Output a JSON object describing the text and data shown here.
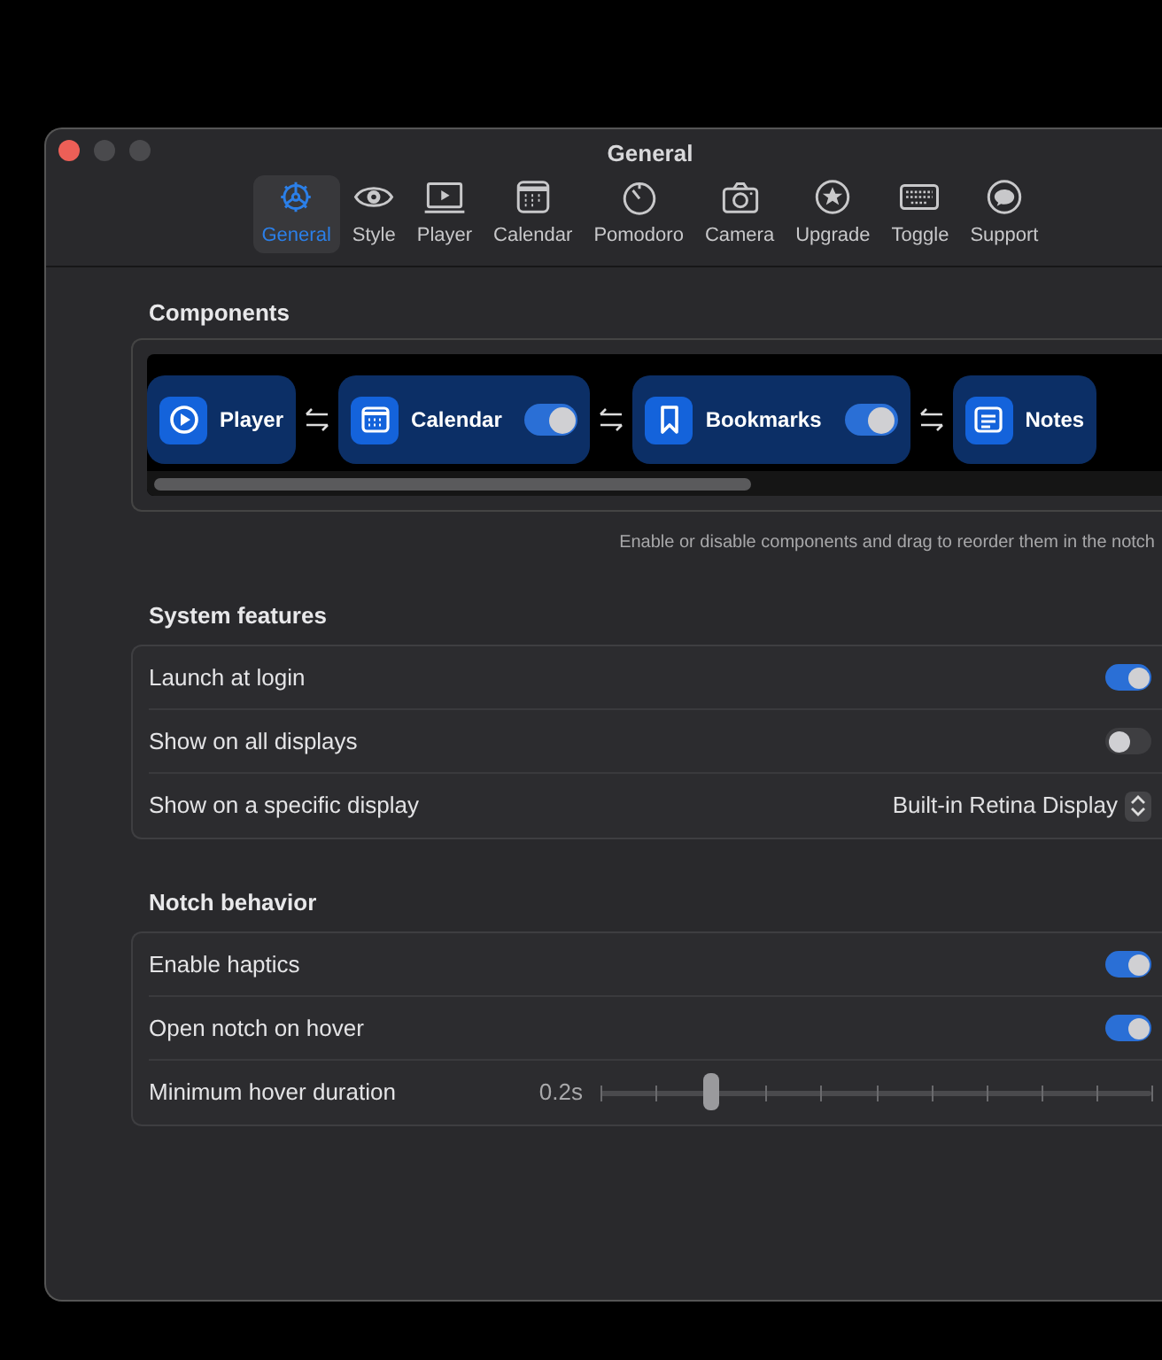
{
  "window": {
    "title": "General"
  },
  "tabs": [
    {
      "label": "General",
      "selected": true
    },
    {
      "label": "Style",
      "selected": false
    },
    {
      "label": "Player",
      "selected": false
    },
    {
      "label": "Calendar",
      "selected": false
    },
    {
      "label": "Pomodoro",
      "selected": false
    },
    {
      "label": "Camera",
      "selected": false
    },
    {
      "label": "Upgrade",
      "selected": false
    },
    {
      "label": "Toggle",
      "selected": false
    },
    {
      "label": "Support",
      "selected": false
    }
  ],
  "components": {
    "title": "Components",
    "items": [
      {
        "label": "Player",
        "kind": "plain"
      },
      {
        "label": "Calendar",
        "kind": "toggle",
        "on": true
      },
      {
        "label": "Bookmarks",
        "kind": "toggle",
        "on": true
      },
      {
        "label": "Notes",
        "kind": "plain"
      }
    ],
    "caption": "Enable or disable components and drag to reorder them in the notch"
  },
  "sections": [
    {
      "title": "System features",
      "rows": [
        {
          "label": "Launch at login",
          "kind": "toggle",
          "on": true
        },
        {
          "label": "Show on all displays",
          "kind": "toggle",
          "on": false
        },
        {
          "label": "Show on a specific display",
          "kind": "select",
          "value": "Built-in Retina Display"
        }
      ]
    },
    {
      "title": "Notch behavior",
      "rows": [
        {
          "label": "Enable haptics",
          "kind": "toggle",
          "on": true
        },
        {
          "label": "Open notch on hover",
          "kind": "toggle",
          "on": true
        },
        {
          "label": "Minimum hover duration",
          "kind": "slider",
          "reading": "0.2s",
          "level": 0.2
        }
      ]
    }
  ]
}
